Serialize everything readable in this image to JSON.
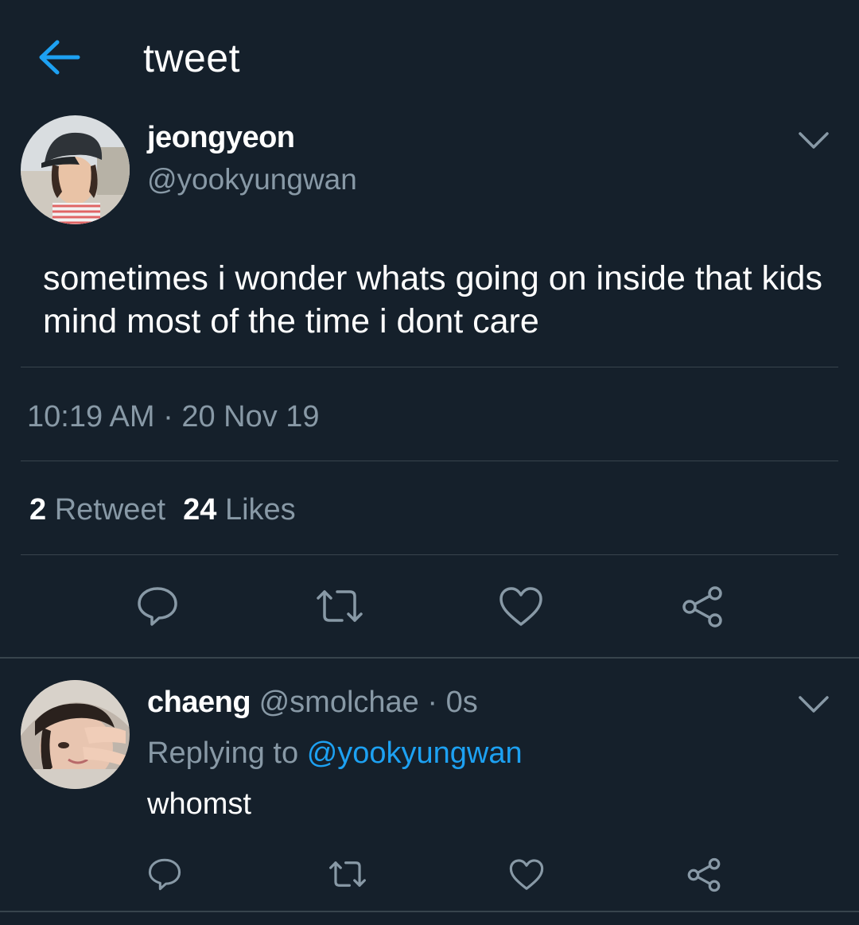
{
  "header": {
    "title": "tweet",
    "back_icon": "arrow-left-icon"
  },
  "colors": {
    "background": "#15202b",
    "accent": "#1da1f2",
    "muted": "#8899a6",
    "divider": "#38444d"
  },
  "tweet": {
    "display_name": "jeongyeon",
    "handle": "@yookyungwan",
    "text": "sometimes i wonder whats going on inside that kids mind most of the time i dont care",
    "timestamp": "10:19 AM · 20 Nov 19",
    "stats": {
      "retweets": "2",
      "retweet_label": "Retweet",
      "likes": "24",
      "likes_label": "Likes"
    },
    "actions": [
      "reply-icon",
      "retweet-icon",
      "like-icon",
      "share-icon"
    ]
  },
  "reply": {
    "display_name": "chaeng",
    "handle": "@smolchae",
    "separator": "·",
    "time": "0s",
    "replying_to_label": "Replying to",
    "replying_to_handle": "@yookyungwan",
    "text": "whomst",
    "actions": [
      "reply-icon",
      "retweet-icon",
      "like-icon",
      "share-icon"
    ]
  }
}
